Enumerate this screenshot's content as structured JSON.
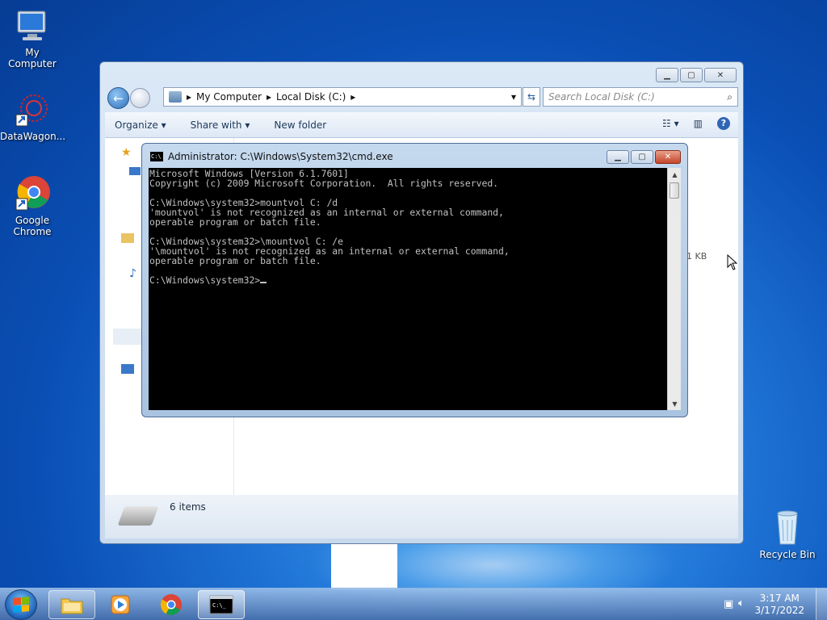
{
  "desktop": {
    "icons": [
      {
        "label": "My Computer"
      },
      {
        "label": "DataWagon..."
      },
      {
        "label": "Google Chrome"
      },
      {
        "label": "Recycle Bin"
      }
    ]
  },
  "explorer": {
    "breadcrumb": [
      "My Computer",
      "Local Disk (C:)"
    ],
    "search_placeholder": "Search Local Disk (C:)",
    "toolbar": {
      "organize": "Organize",
      "share_with": "Share with",
      "new_folder": "New folder"
    },
    "status_text": "6 items",
    "size_fragment": "1 KB"
  },
  "cmd": {
    "title": "Administrator: C:\\Windows\\System32\\cmd.exe",
    "lines": [
      "Microsoft Windows [Version 6.1.7601]",
      "Copyright (c) 2009 Microsoft Corporation.  All rights reserved.",
      "",
      "C:\\Windows\\system32>mountvol C: /d",
      "'mountvol' is not recognized as an internal or external command,",
      "operable program or batch file.",
      "",
      "C:\\Windows\\system32>\\mountvol C: /e",
      "'\\mountvol' is not recognized as an internal or external command,",
      "operable program or batch file.",
      "",
      "C:\\Windows\\system32>"
    ]
  },
  "taskbar": {
    "time": "3:17 AM",
    "date": "3/17/2022",
    "items": [
      "start-button",
      "explorer",
      "media-player",
      "chrome",
      "cmd"
    ]
  }
}
